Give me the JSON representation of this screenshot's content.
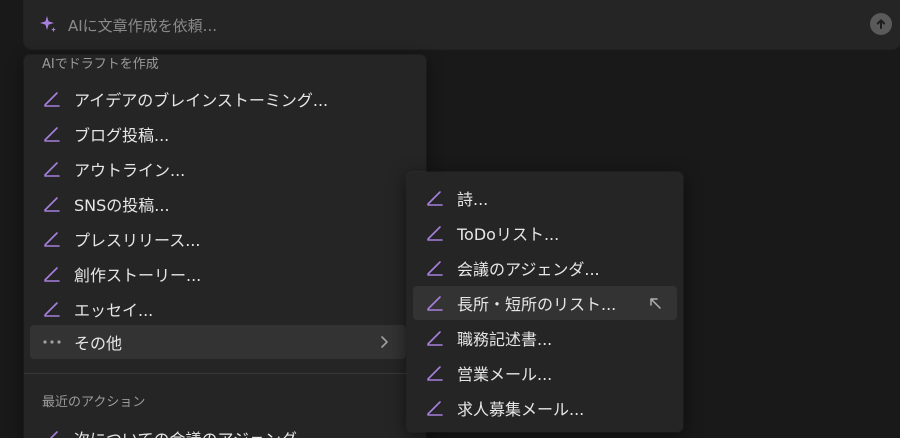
{
  "ai_bar": {
    "placeholder": "AIに文章作成を依頼...",
    "sparkle_icon": "sparkle-icon",
    "send_icon": "arrow-up-circle-icon"
  },
  "main_menu": {
    "section_draft": "AIでドラフトを作成",
    "items": [
      {
        "label": "アイデアのブレインストーミング...",
        "icon": "pen-icon"
      },
      {
        "label": "ブログ投稿...",
        "icon": "pen-icon"
      },
      {
        "label": "アウトライン...",
        "icon": "pen-icon"
      },
      {
        "label": "SNSの投稿...",
        "icon": "pen-icon"
      },
      {
        "label": "プレスリリース...",
        "icon": "pen-icon"
      },
      {
        "label": "創作ストーリー...",
        "icon": "pen-icon"
      },
      {
        "label": "エッセイ...",
        "icon": "pen-icon"
      }
    ],
    "more": {
      "label": "その他",
      "icon": "more-dots-icon",
      "chevron": "chevron-right-icon"
    },
    "section_recent": "最近のアクション",
    "recent_items": [
      {
        "label": "次についての会議のアジェンダ",
        "icon": "pen-icon"
      }
    ]
  },
  "sub_menu": {
    "items": [
      {
        "label": "詩...",
        "icon": "pen-icon"
      },
      {
        "label": "ToDoリスト...",
        "icon": "pen-icon"
      },
      {
        "label": "会議のアジェンダ...",
        "icon": "pen-icon"
      },
      {
        "label": "長所・短所のリスト...",
        "icon": "pen-icon",
        "hovered": true
      },
      {
        "label": "職務記述書...",
        "icon": "pen-icon"
      },
      {
        "label": "営業メール...",
        "icon": "pen-icon"
      },
      {
        "label": "求人募集メール...",
        "icon": "pen-icon"
      }
    ]
  },
  "colors": {
    "background": "#191919",
    "panel": "#252525",
    "hover": "#333333",
    "accent_purple": "#9b6fd0",
    "text": "#e6e6e6",
    "muted_text": "#9b9b9b"
  }
}
